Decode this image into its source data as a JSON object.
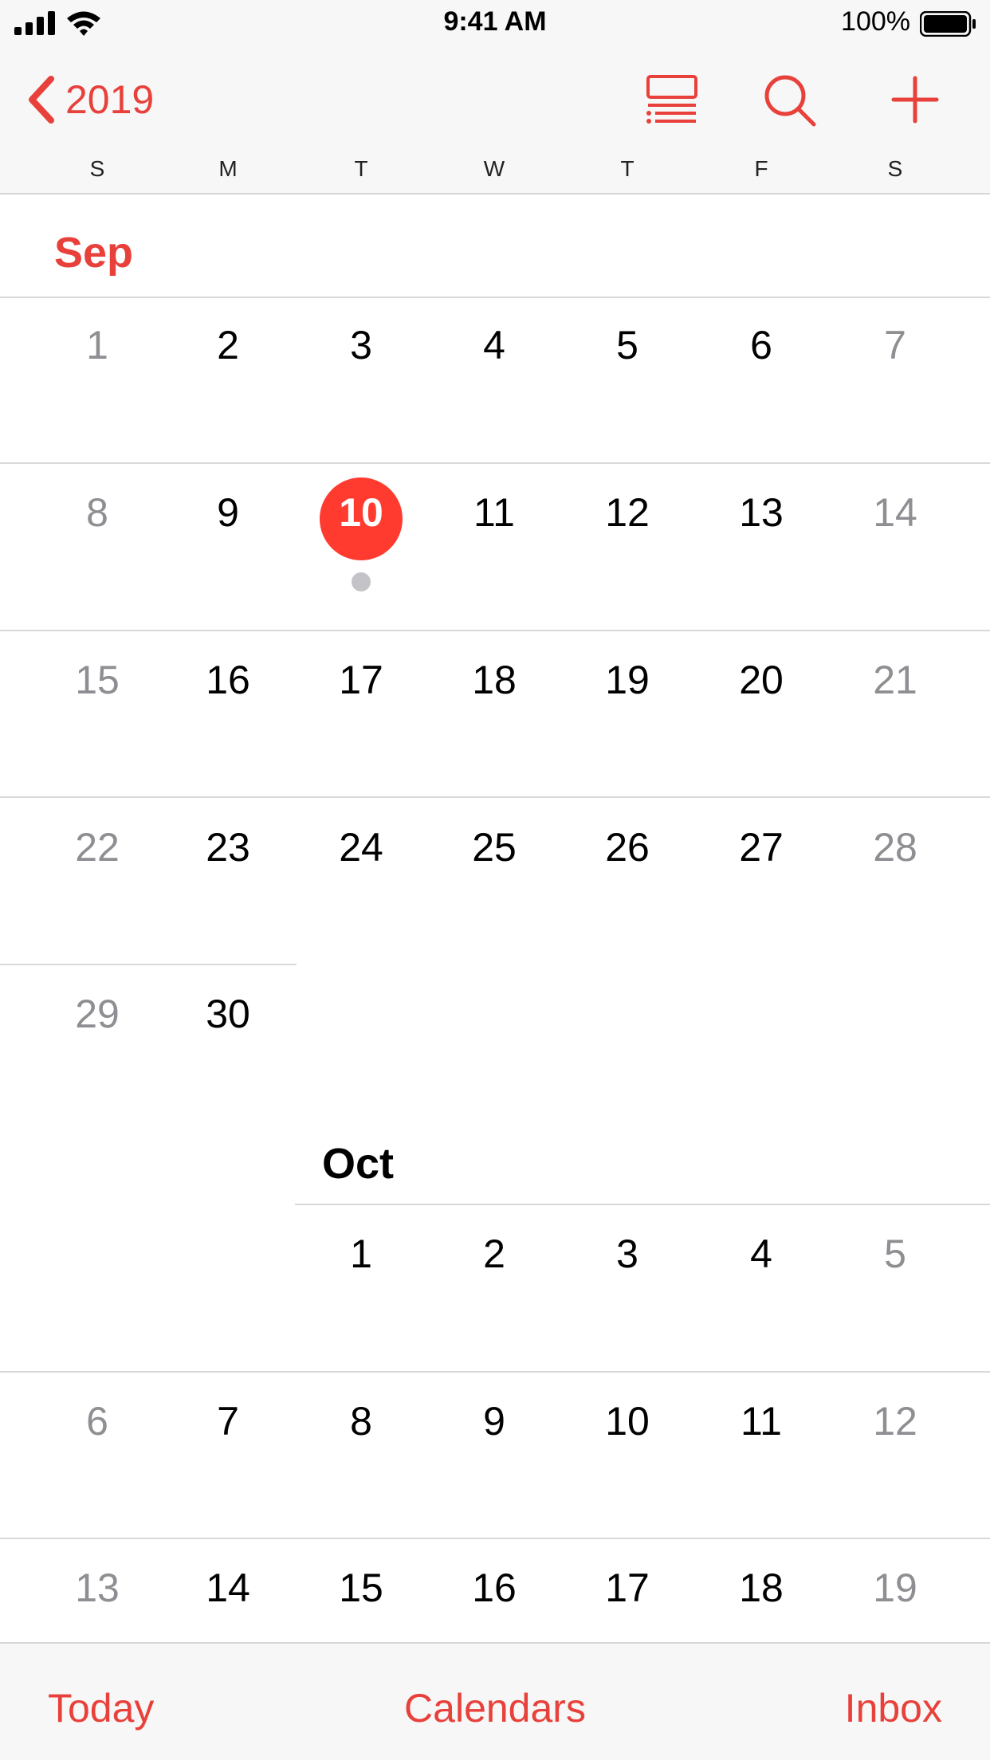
{
  "status_bar": {
    "time": "9:41 AM",
    "battery_percent": "100%",
    "icons": [
      "signal-icon",
      "wifi-icon",
      "battery-icon"
    ]
  },
  "nav": {
    "back_label": "2019",
    "icons": [
      "chevron-left-icon",
      "list-view-icon",
      "search-icon",
      "plus-icon"
    ]
  },
  "weekdays": [
    "S",
    "M",
    "T",
    "W",
    "T",
    "F",
    "S"
  ],
  "months": {
    "sep": {
      "label": "Sep",
      "weeks": [
        [
          "1",
          "2",
          "3",
          "4",
          "5",
          "6",
          "7"
        ],
        [
          "8",
          "9",
          "10",
          "11",
          "12",
          "13",
          "14"
        ],
        [
          "15",
          "16",
          "17",
          "18",
          "19",
          "20",
          "21"
        ],
        [
          "22",
          "23",
          "24",
          "25",
          "26",
          "27",
          "28"
        ],
        [
          "29",
          "30",
          "",
          "",
          "",
          "",
          ""
        ]
      ],
      "today": "10"
    },
    "oct": {
      "label": "Oct",
      "weeks": [
        [
          "",
          "",
          "1",
          "2",
          "3",
          "4",
          "5"
        ],
        [
          "6",
          "7",
          "8",
          "9",
          "10",
          "11",
          "12"
        ],
        [
          "13",
          "14",
          "15",
          "16",
          "17",
          "18",
          "19"
        ]
      ]
    }
  },
  "tabbar": {
    "today_label": "Today",
    "calendars_label": "Calendars",
    "inbox_label": "Inbox"
  },
  "colors": {
    "accent": "#e8403a",
    "today_circle": "#ff3b30",
    "weekend_text": "#8e8e93",
    "event_dot": "#c4c4c8"
  }
}
